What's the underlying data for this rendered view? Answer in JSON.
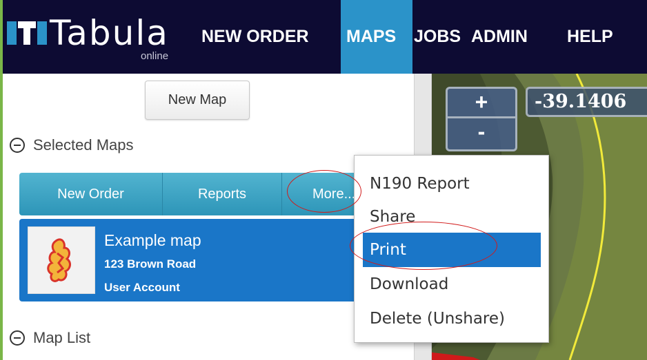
{
  "header": {
    "logo_text": "Tabula",
    "logo_sub": "online",
    "nav": [
      "NEW ORDER",
      "MAPS",
      "JOBS",
      "ADMIN",
      "HELP"
    ],
    "active_nav": "MAPS"
  },
  "sidebar": {
    "new_map_label": "New Map",
    "selected_maps_label": "Selected Maps",
    "actions": [
      "New Order",
      "Reports",
      "More..."
    ],
    "map_card": {
      "title": "Example map",
      "address": "123 Brown Road",
      "account": "User Account"
    },
    "map_list_label": "Map List"
  },
  "map": {
    "zoom_in": "+",
    "zoom_out": "-",
    "coordinate": "-39.1406"
  },
  "dropdown": {
    "items": [
      "N190 Report",
      "Share",
      "Print",
      "Download",
      "Delete (Unshare)"
    ],
    "highlighted": "Print"
  },
  "colors": {
    "nav_bg": "#0d0b33",
    "nav_active": "#2b93c9",
    "accent_blue": "#1a76c8",
    "button_teal": "#3aa5c7",
    "annotation_red": "#d11a1a"
  }
}
